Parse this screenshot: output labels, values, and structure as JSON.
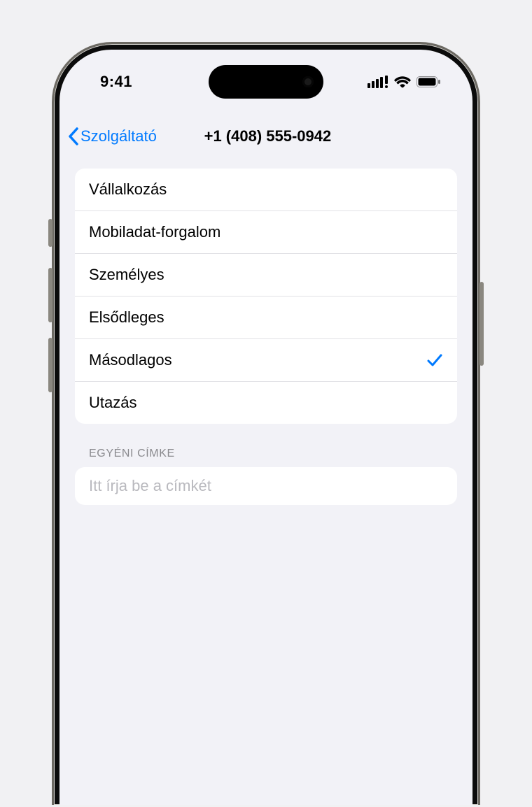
{
  "status": {
    "time": "9:41"
  },
  "nav": {
    "back_label": "Szolgáltató",
    "title": "+1 (408) 555-0942"
  },
  "labels": {
    "items": [
      {
        "label": "Vállalkozás",
        "selected": false
      },
      {
        "label": "Mobiladat-forgalom",
        "selected": false
      },
      {
        "label": "Személyes",
        "selected": false
      },
      {
        "label": "Elsődleges",
        "selected": false
      },
      {
        "label": "Másodlagos",
        "selected": true
      },
      {
        "label": "Utazás",
        "selected": false
      }
    ]
  },
  "custom": {
    "header": "EGYÉNI CÍMKE",
    "placeholder": "Itt írja be a címkét",
    "value": ""
  }
}
